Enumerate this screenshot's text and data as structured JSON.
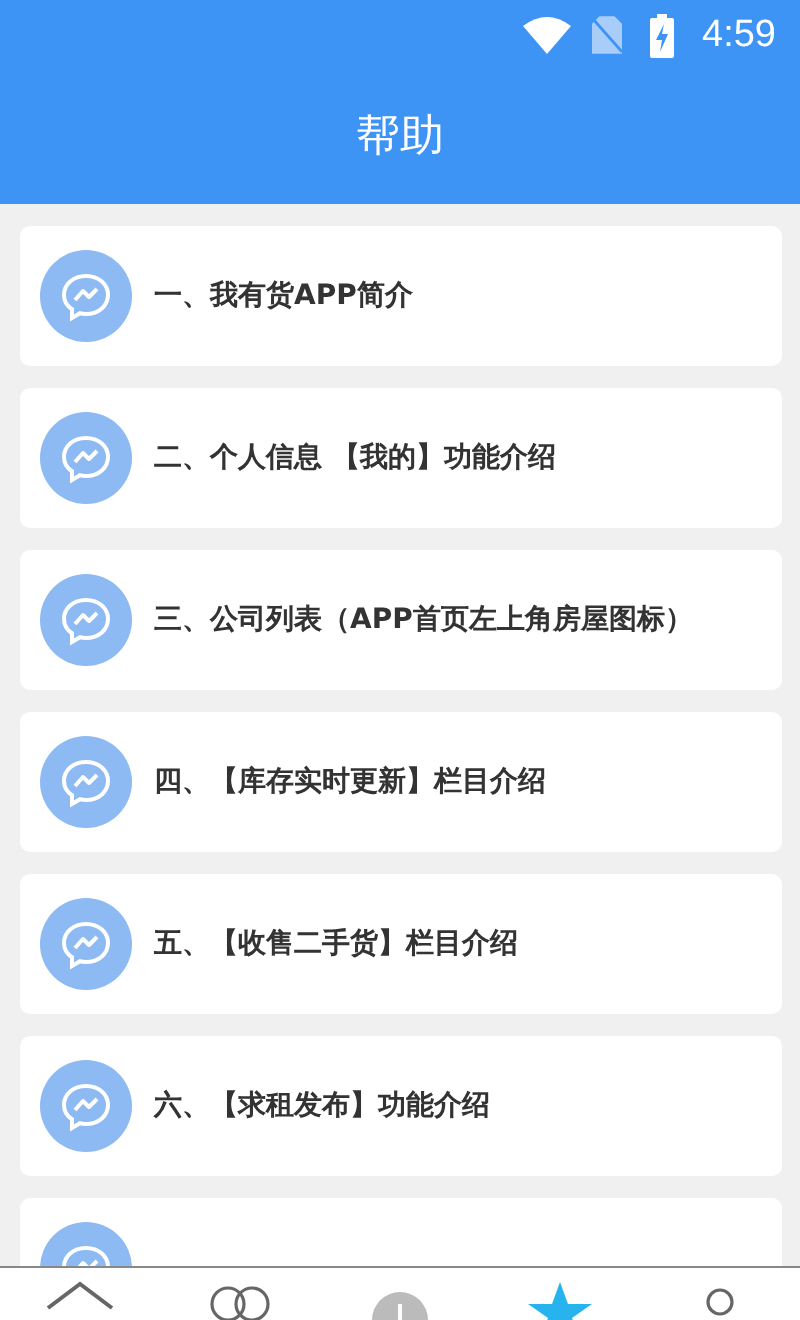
{
  "status_bar": {
    "time": "4:59"
  },
  "header": {
    "title": "帮助"
  },
  "items": [
    {
      "label": "一、我有货APP简介"
    },
    {
      "label": "二、个人信息 【我的】功能介绍"
    },
    {
      "label": "三、公司列表（APP首页左上角房屋图标）"
    },
    {
      "label": "四、【库存实时更新】栏目介绍"
    },
    {
      "label": "五、【收售二手货】栏目介绍"
    },
    {
      "label": "六、【求租发布】功能介绍"
    }
  ],
  "partial_card": {
    "kind": "help-item"
  },
  "tabs": [
    {
      "kind": "home",
      "selected": false
    },
    {
      "kind": "chat",
      "selected": false
    },
    {
      "kind": "add",
      "selected": false
    },
    {
      "kind": "star",
      "selected": true
    },
    {
      "kind": "person",
      "selected": false
    }
  ]
}
